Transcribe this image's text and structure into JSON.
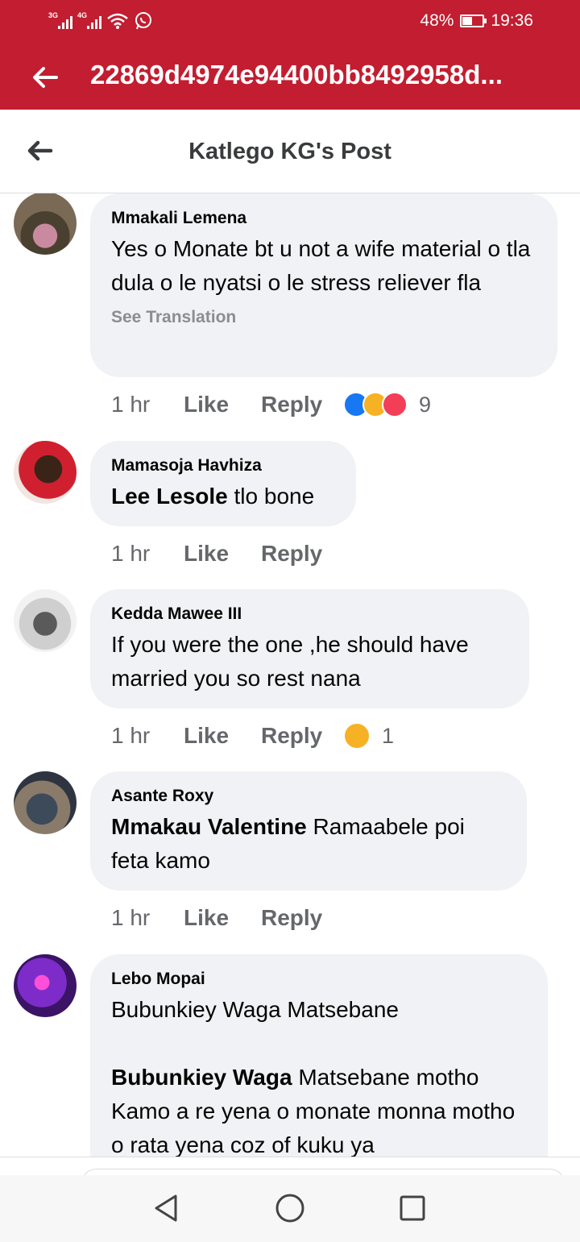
{
  "status_bar": {
    "net1": "3G",
    "net2": "4G",
    "battery": "48%",
    "battery_level": 0.48,
    "time": "19:36"
  },
  "app_bar": {
    "title": "22869d4974e94400bb8492958d..."
  },
  "post_header": {
    "title": "Katlego KG's Post"
  },
  "comments": [
    {
      "author": "Mmakali Lemena",
      "text": "Yes o Monate bt u not a wife material o tla dula o le nyatsi o le stress reliever fla",
      "see_translation": "See Translation",
      "time": "1 hr",
      "like": "Like",
      "reply": "Reply",
      "reactions": [
        "like",
        "haha",
        "love"
      ],
      "reaction_count": "9"
    },
    {
      "author": "Mamasoja Havhiza",
      "mention": "Lee Lesole",
      "text": " tlo bone",
      "time": "1 hr",
      "like": "Like",
      "reply": "Reply"
    },
    {
      "author": "Kedda Mawee III",
      "text": "If you were the one ,he should have married you so rest nana",
      "time": "1 hr",
      "like": "Like",
      "reply": "Reply",
      "reactions": [
        "care"
      ],
      "reaction_count": "1"
    },
    {
      "author": "Asante Roxy",
      "mention": "Mmakau Valentine",
      "text": " Ramaabele poi feta kamo",
      "time": "1 hr",
      "like": "Like",
      "reply": "Reply"
    },
    {
      "author": "Lebo Mopai",
      "line1": "Bubunkiey Waga Matsebane",
      "mention": "Bubunkiey Waga",
      "text": " Matsebane  motho Kamo a re yena o monate monna motho o rata yena coz of kuku ya"
    }
  ],
  "colors": {
    "brand_red": "#c21d30",
    "bubble": "#f0f2f5",
    "secondary_text": "#65676b"
  }
}
